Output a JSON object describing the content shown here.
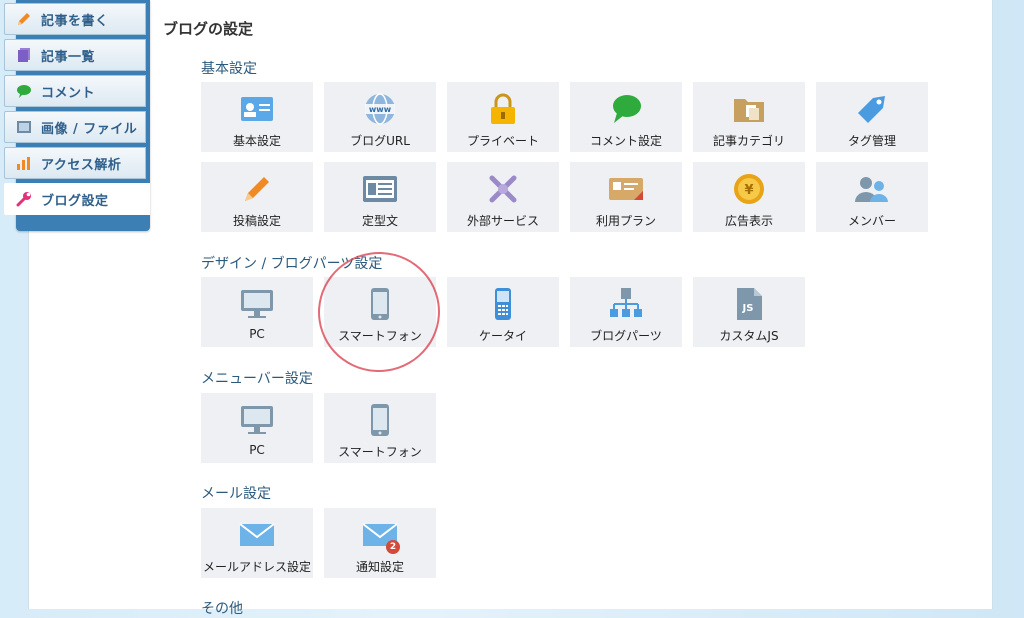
{
  "colors": {
    "accent": "#3b7fb4",
    "tile_bg": "#eef0f3",
    "section_text": "#2b5a7d",
    "annotation": "#d83a4a"
  },
  "sidebar": {
    "items": [
      {
        "label": "記事を書く",
        "icon": "pencil-icon"
      },
      {
        "label": "記事一覧",
        "icon": "document-list-icon"
      },
      {
        "label": "コメント",
        "icon": "speech-bubble-icon"
      },
      {
        "label": "画像 / ファイル",
        "icon": "image-file-icon"
      },
      {
        "label": "アクセス解析",
        "icon": "bar-chart-icon"
      },
      {
        "label": "ブログ設定",
        "icon": "wrench-icon",
        "active": true
      }
    ]
  },
  "page": {
    "title": "ブログの設定"
  },
  "sections": {
    "basic": {
      "title": "基本設定",
      "tiles": [
        "基本設定",
        "ブログURL",
        "プライベート",
        "コメント設定",
        "記事カテゴリ",
        "タグ管理",
        "投稿設定",
        "定型文",
        "外部サービス",
        "利用プラン",
        "広告表示",
        "メンバー"
      ]
    },
    "design": {
      "title": "デザイン / ブログパーツ設定",
      "tiles": [
        "PC",
        "スマートフォン",
        "ケータイ",
        "ブログパーツ",
        "カスタムJS"
      ]
    },
    "menubar": {
      "title": "メニューバー設定",
      "tiles": [
        "PC",
        "スマートフォン"
      ]
    },
    "mail": {
      "title": "メール設定",
      "tiles": [
        "メールアドレス設定",
        "通知設定"
      ],
      "notify_badge": "2"
    },
    "other": {
      "title": "その他"
    }
  }
}
